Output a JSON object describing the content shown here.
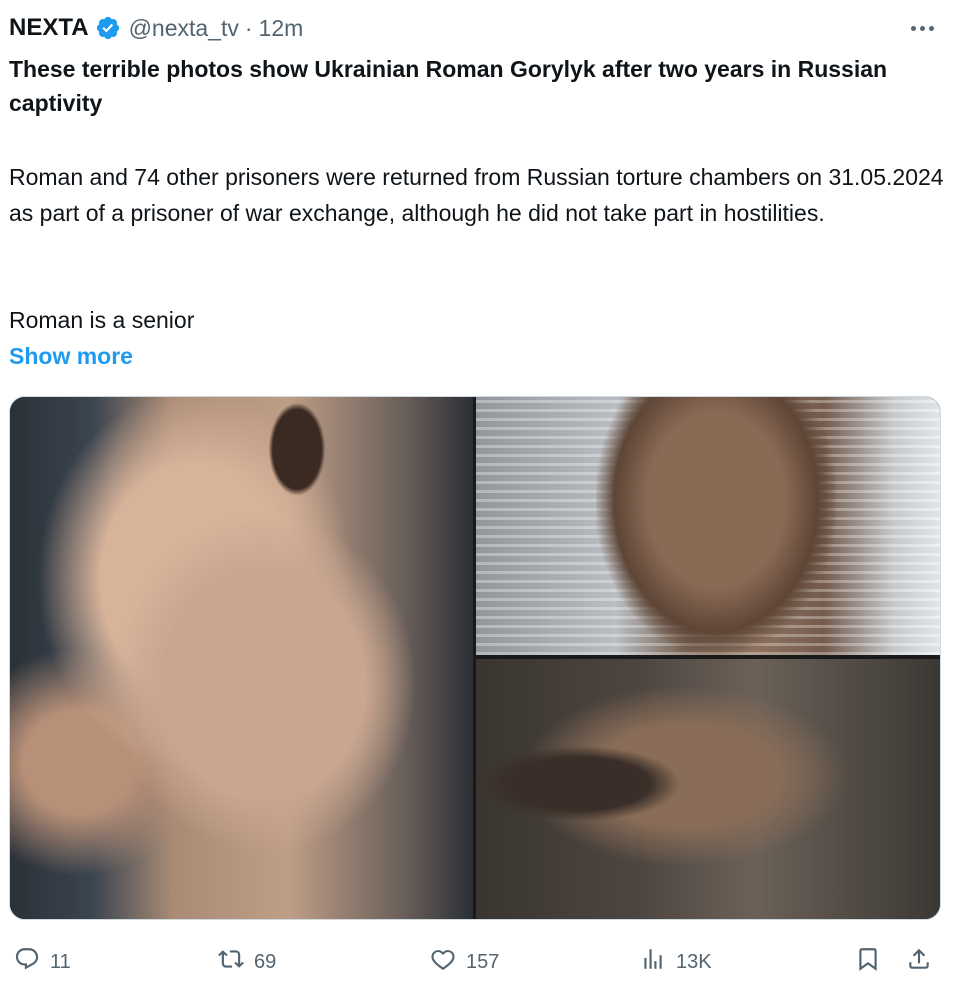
{
  "author": {
    "display_name": "NEXTA",
    "handle": "@nexta_tv",
    "separator": "·",
    "time": "12m",
    "verified_color": "#1d9bf0"
  },
  "tweet": {
    "headline": "These terrible photos show Ukrainian Roman Gorylyk after two years in Russian captivity",
    "paragraph1": "Roman and 74 other prisoners were returned from Russian torture chambers on 31.05.2024 as part of a prisoner of war exchange, although he did not take part in hostilities.",
    "paragraph2": "Roman is a senior",
    "show_more": "Show more"
  },
  "media": {
    "photos": [
      {
        "alt": "photo-1"
      },
      {
        "alt": "photo-2"
      },
      {
        "alt": "photo-3"
      }
    ]
  },
  "actions": {
    "replies": "11",
    "reposts": "69",
    "likes": "157",
    "views": "13K"
  },
  "colors": {
    "text": "#0f1419",
    "secondary": "#536471",
    "link": "#1d9bf0"
  }
}
